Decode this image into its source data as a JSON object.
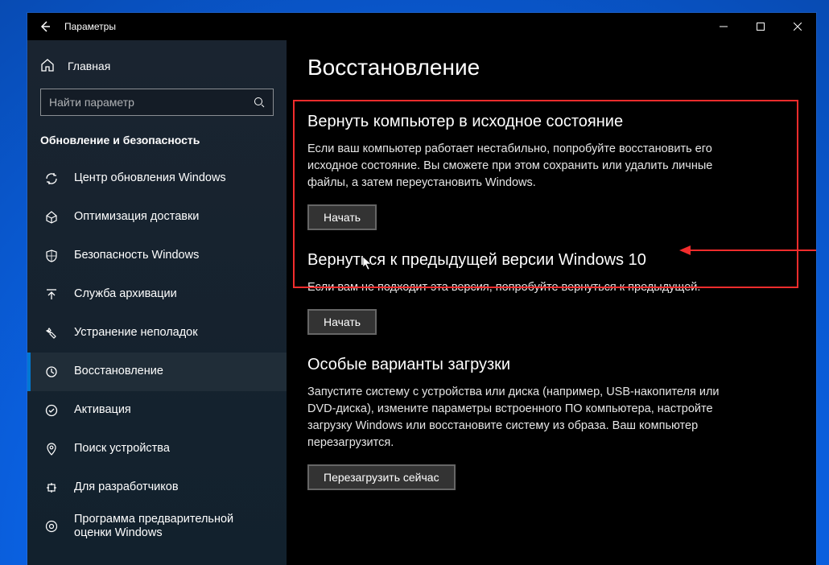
{
  "titlebar": {
    "title": "Параметры"
  },
  "sidebar": {
    "home_label": "Главная",
    "search_placeholder": "Найти параметр",
    "section_title": "Обновление и безопасность",
    "items": [
      {
        "label": "Центр обновления Windows",
        "icon": "sync"
      },
      {
        "label": "Оптимизация доставки",
        "icon": "delivery"
      },
      {
        "label": "Безопасность Windows",
        "icon": "shield"
      },
      {
        "label": "Служба архивации",
        "icon": "backup"
      },
      {
        "label": "Устранение неполадок",
        "icon": "troubleshoot"
      },
      {
        "label": "Восстановление",
        "icon": "recovery",
        "active": true
      },
      {
        "label": "Активация",
        "icon": "activation"
      },
      {
        "label": "Поиск устройства",
        "icon": "find-device"
      },
      {
        "label": "Для разработчиков",
        "icon": "developer"
      },
      {
        "label": "Программа предварительной оценки Windows",
        "icon": "insider"
      }
    ]
  },
  "page": {
    "title": "Восстановление",
    "sections": [
      {
        "heading": "Вернуть компьютер в исходное состояние",
        "body": "Если ваш компьютер работает нестабильно, попробуйте восстановить его исходное состояние. Вы сможете при этом сохранить или удалить личные файлы, а затем переустановить Windows.",
        "button": "Начать"
      },
      {
        "heading": "Вернуться к предыдущей версии Windows 10",
        "body": "Если вам не подходит эта версия, попробуйте вернуться к предыдущей.",
        "button": "Начать"
      },
      {
        "heading": "Особые варианты загрузки",
        "body": "Запустите систему с устройства или диска (например, USB-накопителя или DVD-диска), измените параметры встроенного ПО компьютера, настройте загрузку Windows или восстановите систему из образа. Ваш компьютер перезагрузится.",
        "button": "Перезагрузить сейчас"
      }
    ]
  }
}
